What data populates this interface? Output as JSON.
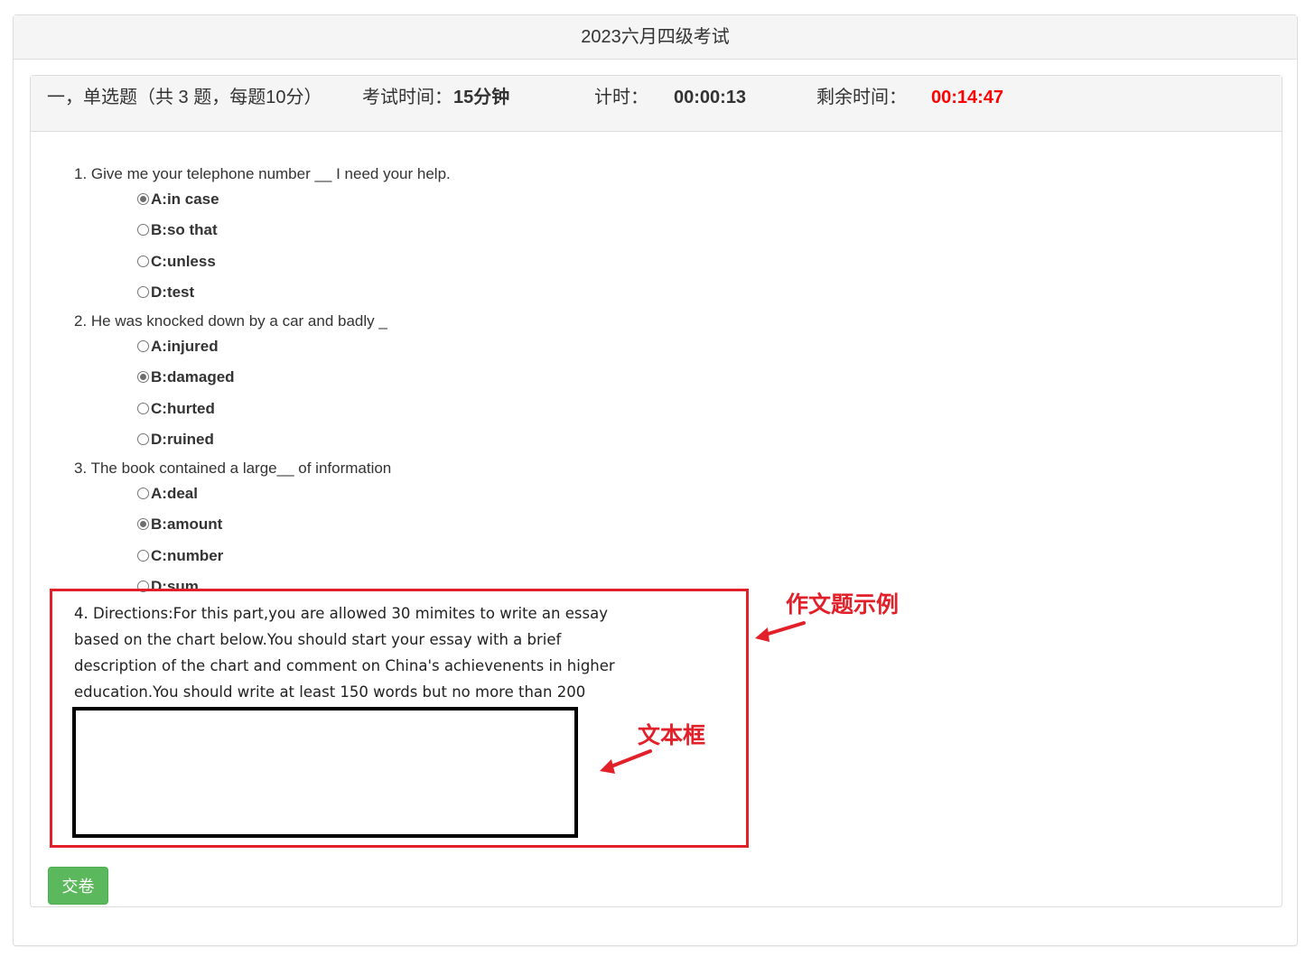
{
  "page": {
    "title": "2023六月四级考试"
  },
  "header": {
    "section_title": "一，单选题（共 3 题，每题10分）",
    "exam_time_label": "考试时间：",
    "exam_time_value": "15分钟",
    "elapsed_label": "计时：",
    "elapsed_value": "00:00:13",
    "remaining_label": "剩余时间：",
    "remaining_value": "00:14:47"
  },
  "questions": [
    {
      "text": "1. Give me your telephone number __ I need your help.",
      "options": [
        {
          "label": "A:in case",
          "selected": true
        },
        {
          "label": "B:so that",
          "selected": false
        },
        {
          "label": "C:unless",
          "selected": false
        },
        {
          "label": "D:test",
          "selected": false
        }
      ]
    },
    {
      "text": "2. He was knocked down by a car and badly _",
      "options": [
        {
          "label": "A:injured",
          "selected": false
        },
        {
          "label": "B:damaged",
          "selected": true
        },
        {
          "label": "C:hurted",
          "selected": false
        },
        {
          "label": "D:ruined",
          "selected": false
        }
      ]
    },
    {
      "text": "3. The book contained a large__ of information",
      "options": [
        {
          "label": "A:deal",
          "selected": false
        },
        {
          "label": "B:amount",
          "selected": true
        },
        {
          "label": "C:number",
          "selected": false
        },
        {
          "label": "D:sum",
          "selected": false
        }
      ]
    }
  ],
  "essay": {
    "text": "4. Directions:For this part,you are allowed 30 mimites to write an essay based on the chart below.You should start your essay with a brief description of the chart and comment on China's achievenents in higher education.You should write at least 150 words but no more than 200",
    "answer_value": ""
  },
  "annotations": {
    "essay_example": "作文题示例",
    "text_box": "文本框",
    "color": "#e2202a"
  },
  "submit_label": "交卷",
  "colors": {
    "remaining": "#ff0000",
    "submit": "#5cb85c"
  }
}
